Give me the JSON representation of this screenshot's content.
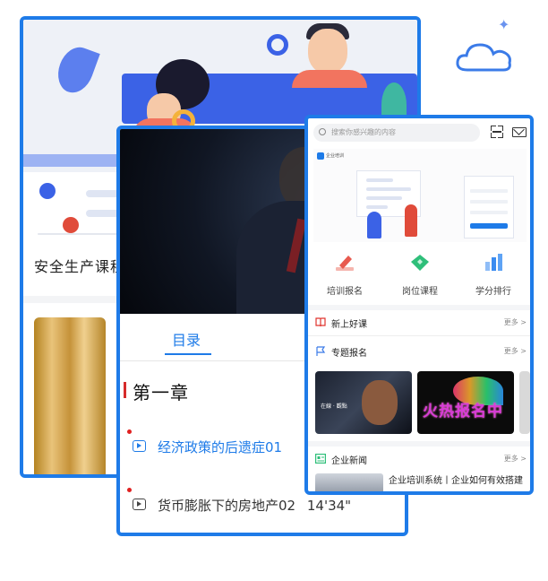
{
  "back_panel": {
    "course_title": "安全生产课程"
  },
  "player_panel": {
    "tab_label": "目录",
    "chapter_title": "第一章",
    "lessons": [
      {
        "title": "经济政策的后遗症01",
        "duration": "",
        "active": true
      },
      {
        "title": "货币膨胀下的房地产02",
        "duration": "14'34\"",
        "active": false
      }
    ]
  },
  "app_panel": {
    "search_placeholder": "搜索你感兴趣的内容",
    "brand_text": "企业培训",
    "quick_links": [
      {
        "label": "培训报名",
        "icon": "pencil-icon",
        "color": "#e85a4f"
      },
      {
        "label": "岗位课程",
        "icon": "diamond-icon",
        "color": "#2fbf7a"
      },
      {
        "label": "学分排行",
        "icon": "bar-chart-icon",
        "color": "#3b8cf0"
      }
    ],
    "sections": [
      {
        "title": "新上好课",
        "more": "更多 >",
        "icon": "book-icon"
      },
      {
        "title": "专题报名",
        "more": "更多 >",
        "icon": "flag-icon"
      },
      {
        "title": "企业新闻",
        "more": "更多 >",
        "icon": "news-icon"
      }
    ],
    "cards": [
      {
        "caption": "在線 · 觀點"
      },
      {
        "caption": "火热报名中"
      }
    ],
    "news": [
      {
        "title": "企业培训系统丨企业如何有效搭建"
      }
    ]
  },
  "colors": {
    "accent": "#1e7be8",
    "danger": "#e02020"
  }
}
